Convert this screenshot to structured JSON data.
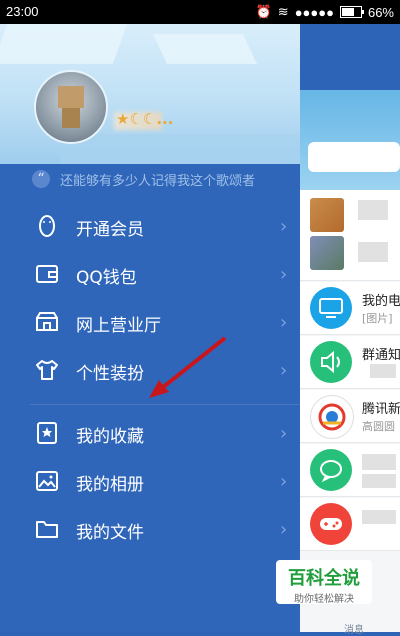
{
  "status_bar": {
    "time": "23:00",
    "signal": "●●●●●",
    "battery": "66%",
    "battery_level": 0.66
  },
  "profile": {
    "nickname": "★☾☾...",
    "signature": "还能够有多少人记得我这个歌颂者"
  },
  "menu": [
    {
      "label": "开通会员",
      "icon": "penguin-icon"
    },
    {
      "label": "QQ钱包",
      "icon": "wallet-icon"
    },
    {
      "label": "网上营业厅",
      "icon": "store-icon"
    },
    {
      "label": "个性装扮",
      "icon": "tshirt-icon"
    },
    {
      "label": "我的收藏",
      "icon": "bookmark-star-icon"
    },
    {
      "label": "我的相册",
      "icon": "photo-icon"
    },
    {
      "label": "我的文件",
      "icon": "folder-icon"
    }
  ],
  "chevron": "›",
  "panel": {
    "rows": [
      {
        "title": "我的电",
        "sub": "[图片]"
      },
      {
        "title": "群通知",
        "sub": ""
      },
      {
        "title": "腾讯新",
        "sub": "高圆圆"
      },
      {
        "title": "",
        "sub": ""
      },
      {
        "title": "",
        "sub": ""
      }
    ],
    "bottom_label": "消息"
  },
  "watermark": {
    "title": "百科全说",
    "subtitle": "助你轻松解决"
  }
}
